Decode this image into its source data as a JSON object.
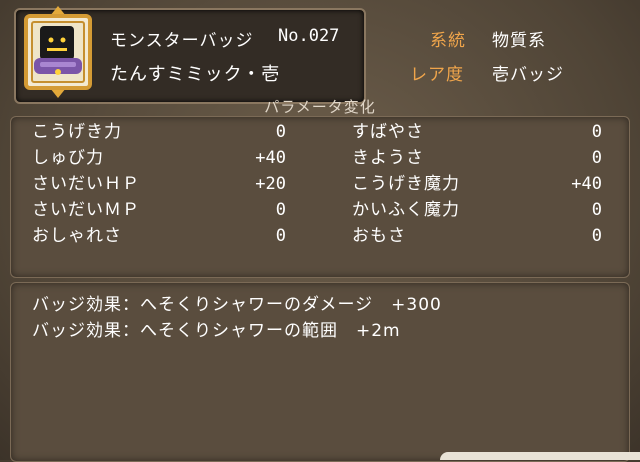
{
  "badge": {
    "category": "モンスターバッジ",
    "number": "No.027",
    "name": "たんすミミック・壱",
    "icon": "mimic-monster-icon"
  },
  "meta": {
    "type_label": "系統",
    "type_value": "物質系",
    "rarity_label": "レア度",
    "rarity_value": "壱バッジ"
  },
  "params": {
    "header": "パラメータ変化",
    "left": [
      {
        "label": "こうげき力",
        "value": "0"
      },
      {
        "label": "しゅび力",
        "value": "+40"
      },
      {
        "label": "さいだいＨＰ",
        "value": "+20"
      },
      {
        "label": "さいだいＭＰ",
        "value": "0"
      },
      {
        "label": "おしゃれさ",
        "value": "0"
      }
    ],
    "right": [
      {
        "label": "すばやさ",
        "value": "0"
      },
      {
        "label": "きようさ",
        "value": "0"
      },
      {
        "label": "こうげき魔力",
        "value": "+40"
      },
      {
        "label": "かいふく魔力",
        "value": "0"
      },
      {
        "label": "おもさ",
        "value": "0"
      }
    ]
  },
  "effects": [
    "バッジ効果：へそくりシャワーのダメージ　+300",
    "バッジ効果：へそくりシャワーの範囲　+2m"
  ],
  "colors": {
    "accent_label": "#f0a54b",
    "text": "#ffffff"
  }
}
